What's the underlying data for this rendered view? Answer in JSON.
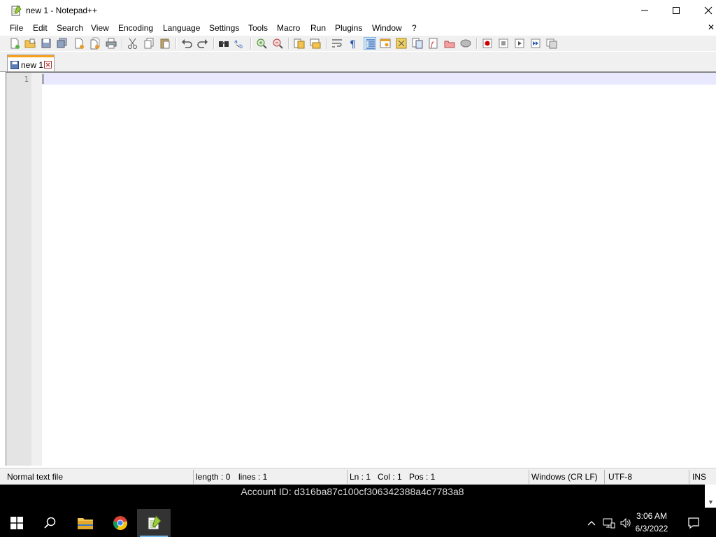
{
  "window": {
    "title": "new 1 - Notepad++",
    "controls": {
      "minimize": "minimize-icon",
      "maximize": "maximize-icon",
      "close": "close-icon"
    }
  },
  "menu": {
    "items": [
      "File",
      "Edit",
      "Search",
      "View",
      "Encoding",
      "Language",
      "Settings",
      "Tools",
      "Macro",
      "Run",
      "Plugins",
      "Window",
      "?"
    ],
    "close_glyph": "✕"
  },
  "toolbar": {
    "icons": [
      "new-file-icon",
      "open-file-icon",
      "save-icon",
      "save-all-icon",
      "close-icon",
      "close-all-icon",
      "print-icon",
      "cut-icon",
      "copy-icon",
      "paste-icon",
      "undo-icon",
      "redo-icon",
      "find-icon",
      "replace-icon",
      "zoom-in-icon",
      "zoom-out-icon",
      "sync-vertical-icon",
      "sync-horizontal-icon",
      "word-wrap-icon",
      "show-all-characters-icon",
      "indent-guide-icon",
      "user-defined-language-icon",
      "document-map-icon",
      "document-list-icon",
      "function-list-icon",
      "folder-as-workspace-icon",
      "monitoring-icon",
      "record-macro-icon",
      "stop-recording-icon",
      "playback-macro-icon",
      "run-macro-multiple-icon",
      "save-macro-icon"
    ],
    "active": "indent-guide-icon"
  },
  "tabs": [
    {
      "label": "new 1",
      "close": "tab-close-icon"
    }
  ],
  "editor": {
    "line_numbers": [
      "1"
    ],
    "content": ""
  },
  "status": {
    "file_type": "Normal text file",
    "length": "length : 0",
    "lines": "lines : 1",
    "ln": "Ln : 1",
    "col": "Col : 1",
    "pos": "Pos : 1",
    "eol": "Windows (CR LF)",
    "encoding": "UTF-8",
    "mode": "INS"
  },
  "overlay": {
    "account": "Account ID: d316ba87c100cf306342388a4c7783a8"
  },
  "taskbar": {
    "apps": [
      "start-icon",
      "search-icon",
      "file-explorer-icon",
      "chrome-icon",
      "notepad-plus-plus-icon"
    ],
    "active_app": "notepad-plus-plus-icon",
    "tray": [
      "show-hidden-icons-icon",
      "network-icon",
      "volume-icon"
    ],
    "time": "3:06 AM",
    "date": "6/3/2022",
    "notifications": "notifications-icon"
  },
  "colors": {
    "tab_accent": "#f9a11b",
    "current_line": "#e8e8ff",
    "taskbar_underline": "#76b9ed",
    "record_red": "#d00000"
  }
}
